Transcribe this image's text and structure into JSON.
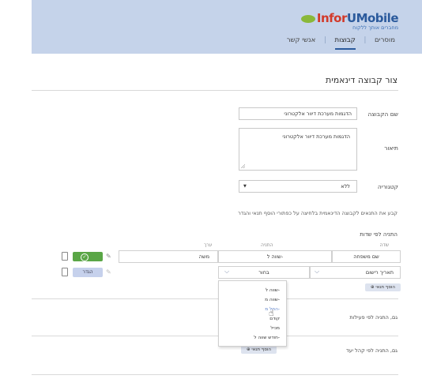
{
  "header": {
    "logo_inform": "Infor",
    "logo_u": "U",
    "logo_mobile": "Mobile",
    "logo_tagline": "מחברים אותך ללקוח",
    "nav": [
      "אנשי קשר",
      "קבוצות",
      "מוסרים"
    ],
    "nav_separator": "|",
    "nav_active": "קבוצות"
  },
  "page": {
    "title": "צור קבוצה דינאמית"
  },
  "form": {
    "group_name_label": "שם הקבוצה",
    "group_name_value": "הדגמות מערכת דיוור אלקטרוני",
    "description_label": "תיאור",
    "description_value": "הדגמות מערכת דיוור אלקטרוני",
    "category_label": "קטגוריה",
    "category_value": "ללא",
    "category_arrow": "▼"
  },
  "conditions": {
    "instructions": "קבע את התנאים לקבוצה הדינאמית בלחיצה על כפתורי הוסף תנאי והגדר",
    "fields_section_title": "התניה לפי שדות",
    "col_field": "שדה",
    "col_condition": "התניה",
    "col_value": "ערך",
    "rows": [
      {
        "field": "שם משפחה",
        "condition": "שווה ל-",
        "value": "משה"
      },
      {
        "field": "תאריך רישום",
        "condition": "בחור",
        "value": "",
        "define_label": "הגדר"
      }
    ],
    "add_condition_label": "הוסף תנאי",
    "activity_section": "גם, התניה לפי פעילות",
    "audience_section": "גם, התניה לפי קהל יעד",
    "add_condition_label_2": "הוסף תנאי"
  },
  "dropdown": {
    "options": [
      "שווה ל-",
      "שווה מ-",
      "החל מ-",
      "קודם",
      "מכיל",
      "חודש שווה ל-"
    ],
    "highlighted": "החל מ-"
  },
  "colors": {
    "header_bg": "#c5d3ea",
    "accent": "#2b5a9c",
    "green": "#5aa646",
    "define_btn": "#c6d1ec"
  }
}
